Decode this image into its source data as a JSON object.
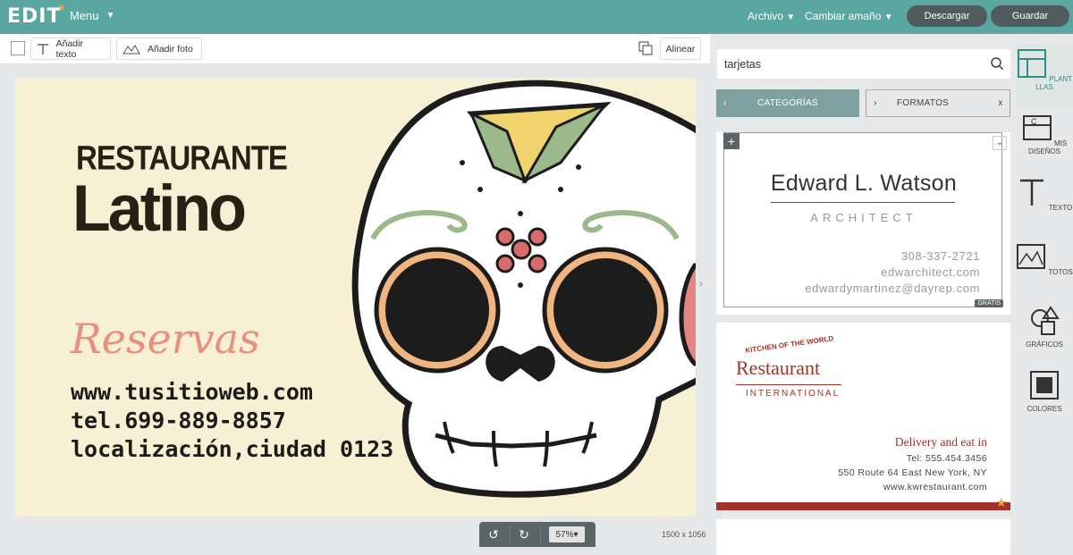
{
  "topbar": {
    "logo": "EDIT",
    "menu_label": "Menu",
    "archivo_label": "Archivo",
    "cambiar_label": "Cambiar  amaño",
    "download_label": "Descargar",
    "save_label": "Guardar"
  },
  "toolbar": {
    "add_text_label": "Añadir texto",
    "add_photo_label": "Añadir foto",
    "align_label": "Alinear"
  },
  "canvas": {
    "title_line1": "RESTAURANTE",
    "title_line2": "Latino",
    "reservas": "Reservas",
    "lines": [
      "www.tusitioweb.com",
      "tel.699-889-8857",
      "localización,ciudad 0123"
    ],
    "background_color": "#f8f0d4"
  },
  "zoom": {
    "level": "57%",
    "dimensions": "1500 x 1056"
  },
  "panel": {
    "search_value": "tarjetas",
    "tab_categories": "CATEGORÍAS",
    "tab_formats": "FORMATOS",
    "tab_close": "x",
    "card1": {
      "name": "Edward L. Watson",
      "role": "ARCHITECT",
      "phone": "308-337-2721",
      "web": "edwarchitect.com",
      "email": "edwardymartinez@dayrep.com",
      "badge": "GRATIS"
    },
    "card2": {
      "kitchen": "KITCHEN OF THE WORLD",
      "name": "Restaurant",
      "sub": "INTERNATIONAL",
      "delivery": "Delivery and eat in",
      "tel": "Tel: 555.454.3456",
      "address": "550 Route 64 East New York, NY",
      "web": "www.kwrestaurant.com"
    }
  },
  "rail": [
    {
      "label": "PLANT LLAS",
      "icon": "templates-icon"
    },
    {
      "label": "MIS DISEÑOS",
      "icon": "my-designs-icon"
    },
    {
      "label": "TEXTO",
      "icon": "text-icon"
    },
    {
      "label": "TOTOS",
      "icon": "photos-icon"
    },
    {
      "label": "GRÁFICOS",
      "icon": "graphics-icon"
    },
    {
      "label": "COLORES",
      "icon": "colors-icon"
    }
  ],
  "colors": {
    "teal": "#5aa6a0",
    "dark_button": "#4f5b5d",
    "restaurant_red": "#a3322b"
  }
}
